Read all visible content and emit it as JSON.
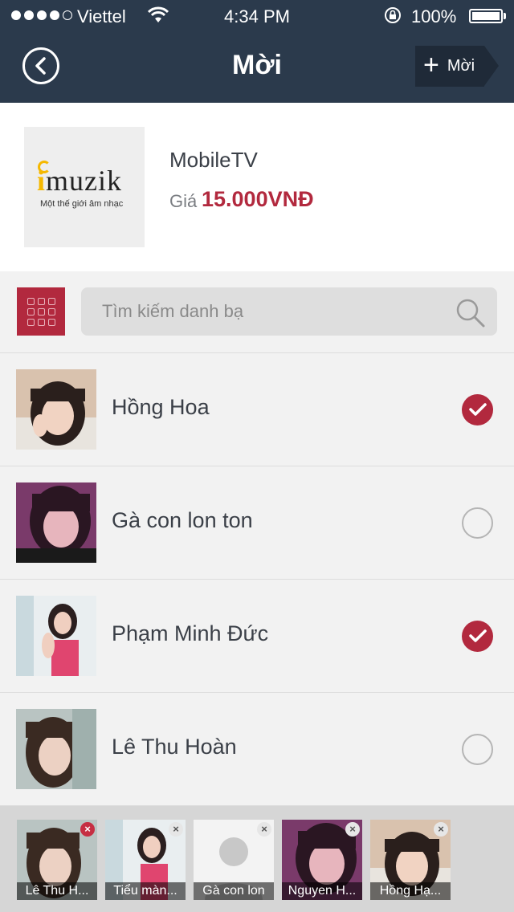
{
  "status_bar": {
    "carrier": "Viettel",
    "time": "4:34 PM",
    "battery": "100%"
  },
  "nav": {
    "title": "Mời",
    "invite_label": "Mời"
  },
  "product": {
    "logo_word": "muzik",
    "logo_tagline": "Một thế giới âm nhạc",
    "name": "MobileTV",
    "price_label": "Giá",
    "price": "15.000VNĐ"
  },
  "search": {
    "placeholder": "Tìm kiếm danh bạ"
  },
  "contacts": [
    {
      "name": "Hồng Hoa",
      "checked": true
    },
    {
      "name": "Gà con lon ton",
      "checked": false
    },
    {
      "name": "Phạm Minh Đức",
      "checked": true
    },
    {
      "name": "Lê Thu Hoàn",
      "checked": false
    }
  ],
  "selected": [
    {
      "label": "Lê Thu H..."
    },
    {
      "label": "Tiểu màn..."
    },
    {
      "label": "Gà con lon"
    },
    {
      "label": "Nguyen H..."
    },
    {
      "label": "Hồng Hạ..."
    }
  ],
  "colors": {
    "nav_bg": "#2b3a4c",
    "accent": "#b2293e",
    "list_bg": "#f2f2f2"
  }
}
